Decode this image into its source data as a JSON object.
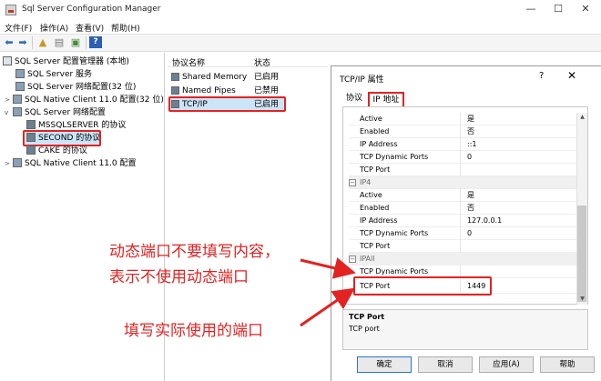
{
  "window": {
    "title": "Sql Server Configuration Manager",
    "minimize": "—",
    "maximize": "☐",
    "close": "✕"
  },
  "menu": [
    "文件(F)",
    "操作(A)",
    "查看(V)",
    "帮助(H)"
  ],
  "tree": {
    "root": "SQL Server 配置管理器 (本地)",
    "services": "SQL Server 服务",
    "network32": "SQL Server 网络配置(32 位)",
    "native32": "SQL Native Client 11.0 配置(32 位)",
    "network": "SQL Server 网络配置",
    "mssqlserver": "MSSQLSERVER 的协议",
    "second": "SECOND 的协议",
    "cake": "CAKE 的协议",
    "native": "SQL Native Client 11.0 配置"
  },
  "list": {
    "col_name": "协议名称",
    "col_status": "状态",
    "rows": [
      {
        "name": "Shared Memory",
        "status": "已启用"
      },
      {
        "name": "Named Pipes",
        "status": "已禁用"
      },
      {
        "name": "TCP/IP",
        "status": "已启用"
      }
    ]
  },
  "dialog": {
    "title": "TCP/IP 属性",
    "help": "?",
    "close": "✕",
    "tab_protocol": "协议",
    "tab_ip": "IP 地址",
    "rows1": [
      {
        "k": "Active",
        "v": "是"
      },
      {
        "k": "Enabled",
        "v": "否"
      },
      {
        "k": "IP Address",
        "v": "::1"
      },
      {
        "k": "TCP Dynamic Ports",
        "v": "0"
      },
      {
        "k": "TCP Port",
        "v": ""
      }
    ],
    "ip4_label": "IP4",
    "rows2": [
      {
        "k": "Active",
        "v": "是"
      },
      {
        "k": "Enabled",
        "v": "否"
      },
      {
        "k": "IP Address",
        "v": "127.0.0.1"
      },
      {
        "k": "TCP Dynamic Ports",
        "v": "0"
      },
      {
        "k": "TCP Port",
        "v": ""
      }
    ],
    "ipall_label": "IPAll",
    "ipall_dynamic": "TCP Dynamic Ports",
    "ipall_port_key": "TCP Port",
    "ipall_port_val": "1449",
    "desc_title": "TCP Port",
    "desc_text": "TCP port",
    "buttons": {
      "ok": "确定",
      "cancel": "取消",
      "apply": "应用(A)",
      "help": "帮助"
    }
  },
  "annotations": {
    "line1": "动态端口不要填写内容，",
    "line2": "表示不使用动态端口",
    "line3": "填写实际使用的端口"
  },
  "colors": {
    "highlight": "#e32222",
    "accent": "#2a76d2"
  }
}
